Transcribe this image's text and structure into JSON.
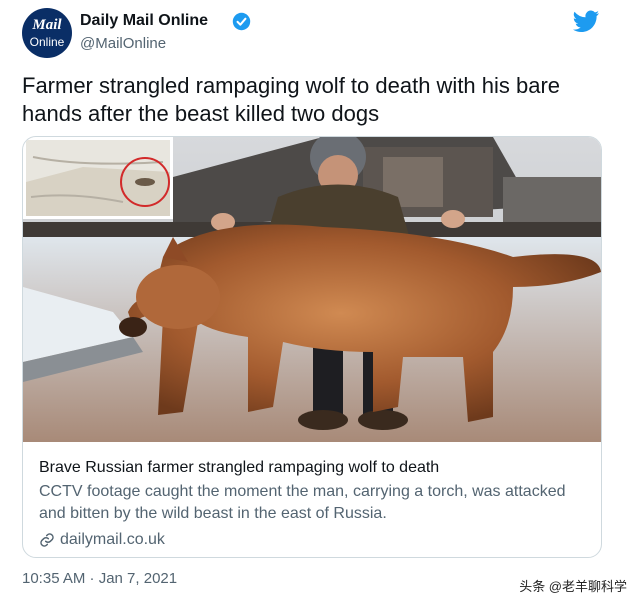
{
  "header": {
    "avatar_line1": "Mail",
    "avatar_line2": "Online",
    "display_name": "Daily Mail Online",
    "handle": "@MailOnline"
  },
  "tweet": {
    "text": "Farmer strangled rampaging wolf to death with his bare hands after the beast killed two dogs",
    "timestamp": "10:35 AM · Jan 7, 2021"
  },
  "card": {
    "title": "Brave Russian farmer strangled rampaging wolf to death",
    "description": "CCTV footage caught the moment the man, carrying a torch, was attacked and bitten by the wild beast in the east of Russia.",
    "domain": "dailymail.co.uk"
  },
  "watermark": "头条 @老羊聊科学",
  "icons": {
    "verified": "verified-badge-icon",
    "brand": "twitter-bird-icon",
    "link": "link-icon"
  },
  "colors": {
    "twitter_blue": "#1d9bf0",
    "avatar_bg": "#0a2e66",
    "secondary_text": "#536471",
    "border": "#cfd9de"
  }
}
